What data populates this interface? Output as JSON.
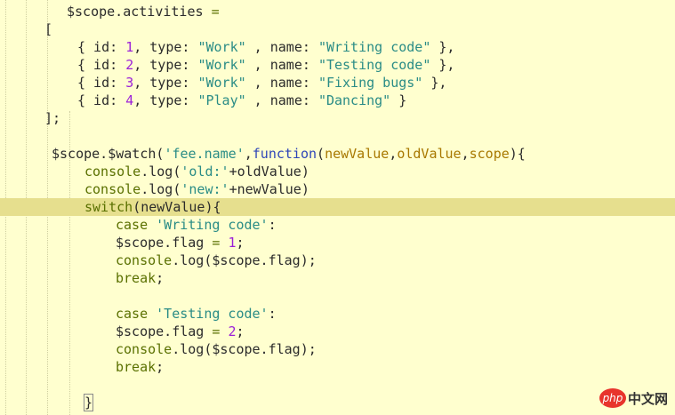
{
  "editor": {
    "highlight_line": 11,
    "lines": [
      {
        "indent": 75,
        "tokens": [
          [
            "$scope.activities ",
            "d"
          ],
          [
            "=",
            "o"
          ]
        ]
      },
      {
        "indent": 50,
        "tokens": [
          [
            "[",
            "d"
          ]
        ]
      },
      {
        "indent": 87,
        "tokens": [
          [
            "{ id: ",
            "d"
          ],
          [
            "1",
            "n"
          ],
          [
            ", type: ",
            "d"
          ],
          [
            "\"Work\"",
            "s"
          ],
          [
            " , name: ",
            "d"
          ],
          [
            "\"Writing code\"",
            "s"
          ],
          [
            " },",
            "d"
          ]
        ]
      },
      {
        "indent": 87,
        "tokens": [
          [
            "{ id: ",
            "d"
          ],
          [
            "2",
            "n"
          ],
          [
            ", type: ",
            "d"
          ],
          [
            "\"Work\"",
            "s"
          ],
          [
            " , name: ",
            "d"
          ],
          [
            "\"Testing code\"",
            "s"
          ],
          [
            " },",
            "d"
          ]
        ]
      },
      {
        "indent": 87,
        "tokens": [
          [
            "{ id: ",
            "d"
          ],
          [
            "3",
            "n"
          ],
          [
            ", type: ",
            "d"
          ],
          [
            "\"Work\"",
            "s"
          ],
          [
            " , name: ",
            "d"
          ],
          [
            "\"Fixing bugs\"",
            "s"
          ],
          [
            " },",
            "d"
          ]
        ]
      },
      {
        "indent": 87,
        "tokens": [
          [
            "{ id: ",
            "d"
          ],
          [
            "4",
            "n"
          ],
          [
            ", type: ",
            "d"
          ],
          [
            "\"Play\"",
            "s"
          ],
          [
            " , name: ",
            "d"
          ],
          [
            "\"Dancing\"",
            "s"
          ],
          [
            " }",
            "d"
          ]
        ]
      },
      {
        "indent": 50,
        "tokens": [
          [
            "];",
            "d"
          ]
        ]
      },
      {
        "indent": 0,
        "tokens": []
      },
      {
        "indent": 58,
        "tokens": [
          [
            "$scope.$watch(",
            "d"
          ],
          [
            "'fee.name'",
            "s"
          ],
          [
            ",",
            "d"
          ],
          [
            "function",
            "f"
          ],
          [
            "(",
            "d"
          ],
          [
            "newValue",
            "p"
          ],
          [
            ",",
            "d"
          ],
          [
            "oldValue",
            "p"
          ],
          [
            ",",
            "d"
          ],
          [
            "scope",
            "p"
          ],
          [
            "){",
            "d"
          ]
        ]
      },
      {
        "indent": 95,
        "tokens": [
          [
            "console",
            "k"
          ],
          [
            ".log(",
            "d"
          ],
          [
            "'old:'",
            "s"
          ],
          [
            "+oldValue)",
            "d"
          ]
        ]
      },
      {
        "indent": 95,
        "tokens": [
          [
            "console",
            "k"
          ],
          [
            ".log(",
            "d"
          ],
          [
            "'new:'",
            "s"
          ],
          [
            "+newValue)",
            "d"
          ]
        ]
      },
      {
        "indent": 95,
        "tokens": [
          [
            "switch",
            "k"
          ],
          [
            "(newValue){",
            "d"
          ]
        ]
      },
      {
        "indent": 130,
        "tokens": [
          [
            "case ",
            "k"
          ],
          [
            "'Writing code'",
            "s"
          ],
          [
            ":",
            "d"
          ]
        ]
      },
      {
        "indent": 130,
        "tokens": [
          [
            "$scope.flag ",
            "d"
          ],
          [
            "=",
            "o"
          ],
          [
            " ",
            "d"
          ],
          [
            "1",
            "n"
          ],
          [
            ";",
            "d"
          ]
        ]
      },
      {
        "indent": 130,
        "tokens": [
          [
            "console",
            "k"
          ],
          [
            ".log($scope.flag);",
            "d"
          ]
        ]
      },
      {
        "indent": 130,
        "tokens": [
          [
            "break",
            "k"
          ],
          [
            ";",
            "d"
          ]
        ]
      },
      {
        "indent": 0,
        "tokens": []
      },
      {
        "indent": 130,
        "tokens": [
          [
            "case ",
            "k"
          ],
          [
            "'Testing code'",
            "s"
          ],
          [
            ":",
            "d"
          ]
        ]
      },
      {
        "indent": 130,
        "tokens": [
          [
            "$scope.flag ",
            "d"
          ],
          [
            "=",
            "o"
          ],
          [
            " ",
            "d"
          ],
          [
            "2",
            "n"
          ],
          [
            ";",
            "d"
          ]
        ]
      },
      {
        "indent": 130,
        "tokens": [
          [
            "console",
            "k"
          ],
          [
            ".log($scope.flag);",
            "d"
          ]
        ]
      },
      {
        "indent": 130,
        "tokens": [
          [
            "break",
            "k"
          ],
          [
            ";",
            "d"
          ]
        ]
      },
      {
        "indent": 0,
        "tokens": []
      },
      {
        "indent": 95,
        "tokens": [
          [
            "}",
            "d brace-box"
          ]
        ]
      }
    ]
  },
  "watermark": {
    "logo": "php",
    "text": "中文网"
  }
}
